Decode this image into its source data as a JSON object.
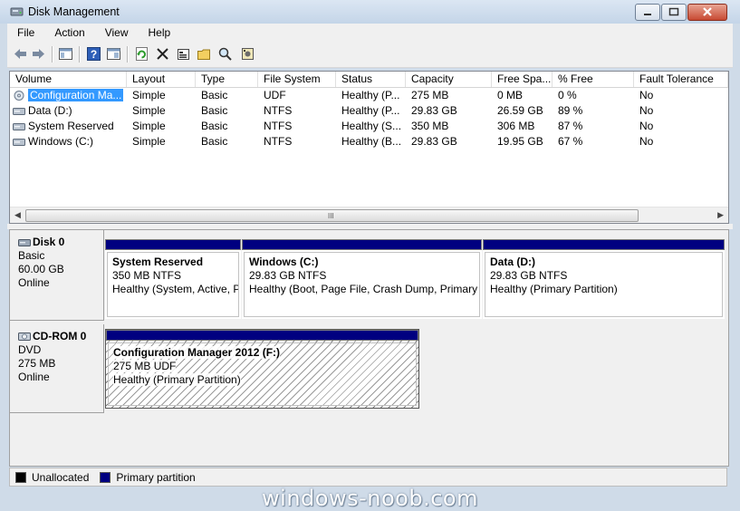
{
  "window": {
    "title": "Disk Management"
  },
  "menu": [
    "File",
    "Action",
    "View",
    "Help"
  ],
  "toolbar_icons": [
    "back-arrow-icon",
    "forward-arrow-icon",
    "console-tree-icon",
    "help-icon",
    "properties-pane-icon",
    "refresh-icon",
    "delete-icon",
    "properties-icon",
    "open-icon",
    "search-icon",
    "rescan-icon"
  ],
  "volume_list": {
    "columns": [
      "Volume",
      "Layout",
      "Type",
      "File System",
      "Status",
      "Capacity",
      "Free Spa...",
      "% Free",
      "Fault Tolerance"
    ],
    "rows": [
      [
        "Configuration Ma...",
        "Simple",
        "Basic",
        "UDF",
        "Healthy (P...",
        "275 MB",
        "0 MB",
        "0 %",
        "No"
      ],
      [
        "Data (D:)",
        "Simple",
        "Basic",
        "NTFS",
        "Healthy (P...",
        "29.83 GB",
        "26.59 GB",
        "89 %",
        "No"
      ],
      [
        "System Reserved",
        "Simple",
        "Basic",
        "NTFS",
        "Healthy (S...",
        "350 MB",
        "306 MB",
        "87 %",
        "No"
      ],
      [
        "Windows (C:)",
        "Simple",
        "Basic",
        "NTFS",
        "Healthy (B...",
        "29.83 GB",
        "19.95 GB",
        "67 %",
        "No"
      ]
    ],
    "scroll_grip": "III"
  },
  "disks": [
    {
      "name": "Disk 0",
      "type": "Basic",
      "size": "60.00 GB",
      "status": "Online",
      "partitions": [
        {
          "name": "System Reserved",
          "size": "350 MB NTFS",
          "status": "Healthy (System, Active, Primary Partition)"
        },
        {
          "name": "Windows  (C:)",
          "size": "29.83 GB NTFS",
          "status": "Healthy (Boot, Page File, Crash Dump, Primary Partition)"
        },
        {
          "name": "Data  (D:)",
          "size": "29.83 GB NTFS",
          "status": "Healthy (Primary Partition)"
        }
      ]
    },
    {
      "name": "CD-ROM 0",
      "type": "DVD",
      "size": "275 MB",
      "status": "Online",
      "partitions": [
        {
          "name": "Configuration Manager 2012  (F:)",
          "size": "275 MB UDF",
          "status": "Healthy (Primary Partition)"
        }
      ]
    }
  ],
  "legend": [
    {
      "label": "Unallocated",
      "color": "#000000"
    },
    {
      "label": "Primary partition",
      "color": "#000080"
    }
  ],
  "watermark": "windows-noob.com"
}
